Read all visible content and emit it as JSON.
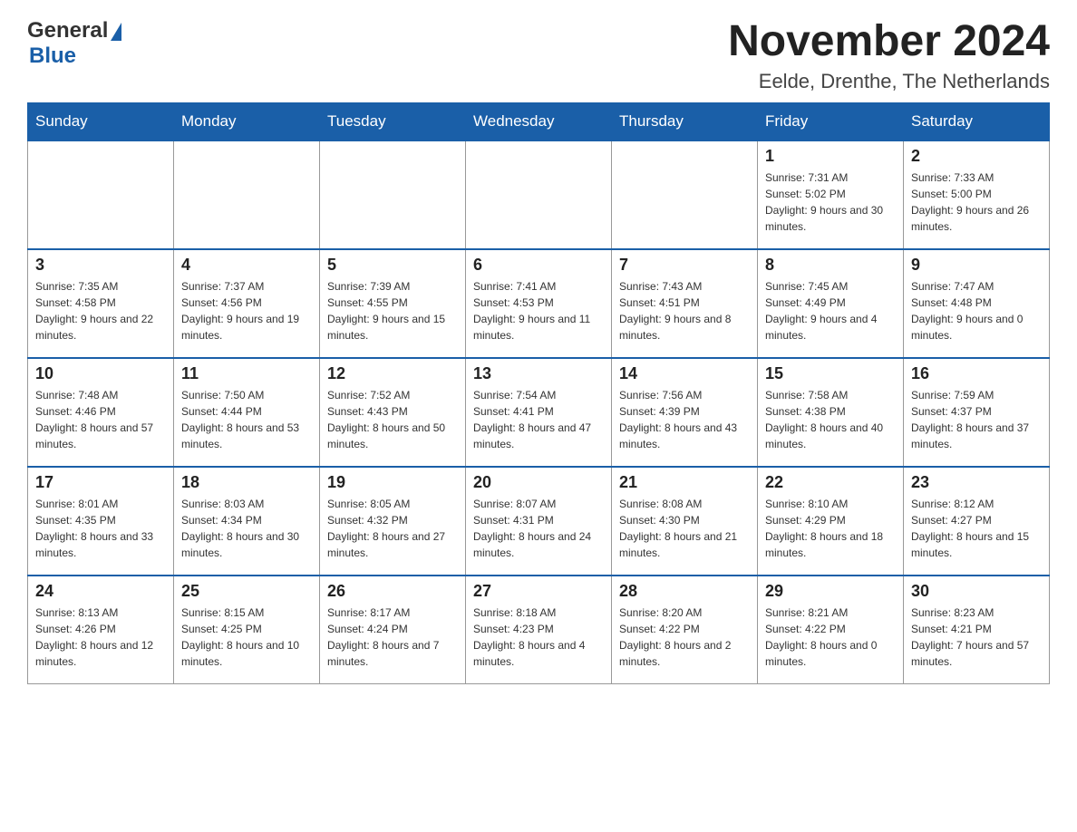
{
  "header": {
    "logo_general": "General",
    "logo_blue": "Blue",
    "title": "November 2024",
    "subtitle": "Eelde, Drenthe, The Netherlands"
  },
  "weekdays": [
    "Sunday",
    "Monday",
    "Tuesday",
    "Wednesday",
    "Thursday",
    "Friday",
    "Saturday"
  ],
  "weeks": [
    [
      {
        "day": "",
        "info": ""
      },
      {
        "day": "",
        "info": ""
      },
      {
        "day": "",
        "info": ""
      },
      {
        "day": "",
        "info": ""
      },
      {
        "day": "",
        "info": ""
      },
      {
        "day": "1",
        "info": "Sunrise: 7:31 AM\nSunset: 5:02 PM\nDaylight: 9 hours and 30 minutes."
      },
      {
        "day": "2",
        "info": "Sunrise: 7:33 AM\nSunset: 5:00 PM\nDaylight: 9 hours and 26 minutes."
      }
    ],
    [
      {
        "day": "3",
        "info": "Sunrise: 7:35 AM\nSunset: 4:58 PM\nDaylight: 9 hours and 22 minutes."
      },
      {
        "day": "4",
        "info": "Sunrise: 7:37 AM\nSunset: 4:56 PM\nDaylight: 9 hours and 19 minutes."
      },
      {
        "day": "5",
        "info": "Sunrise: 7:39 AM\nSunset: 4:55 PM\nDaylight: 9 hours and 15 minutes."
      },
      {
        "day": "6",
        "info": "Sunrise: 7:41 AM\nSunset: 4:53 PM\nDaylight: 9 hours and 11 minutes."
      },
      {
        "day": "7",
        "info": "Sunrise: 7:43 AM\nSunset: 4:51 PM\nDaylight: 9 hours and 8 minutes."
      },
      {
        "day": "8",
        "info": "Sunrise: 7:45 AM\nSunset: 4:49 PM\nDaylight: 9 hours and 4 minutes."
      },
      {
        "day": "9",
        "info": "Sunrise: 7:47 AM\nSunset: 4:48 PM\nDaylight: 9 hours and 0 minutes."
      }
    ],
    [
      {
        "day": "10",
        "info": "Sunrise: 7:48 AM\nSunset: 4:46 PM\nDaylight: 8 hours and 57 minutes."
      },
      {
        "day": "11",
        "info": "Sunrise: 7:50 AM\nSunset: 4:44 PM\nDaylight: 8 hours and 53 minutes."
      },
      {
        "day": "12",
        "info": "Sunrise: 7:52 AM\nSunset: 4:43 PM\nDaylight: 8 hours and 50 minutes."
      },
      {
        "day": "13",
        "info": "Sunrise: 7:54 AM\nSunset: 4:41 PM\nDaylight: 8 hours and 47 minutes."
      },
      {
        "day": "14",
        "info": "Sunrise: 7:56 AM\nSunset: 4:39 PM\nDaylight: 8 hours and 43 minutes."
      },
      {
        "day": "15",
        "info": "Sunrise: 7:58 AM\nSunset: 4:38 PM\nDaylight: 8 hours and 40 minutes."
      },
      {
        "day": "16",
        "info": "Sunrise: 7:59 AM\nSunset: 4:37 PM\nDaylight: 8 hours and 37 minutes."
      }
    ],
    [
      {
        "day": "17",
        "info": "Sunrise: 8:01 AM\nSunset: 4:35 PM\nDaylight: 8 hours and 33 minutes."
      },
      {
        "day": "18",
        "info": "Sunrise: 8:03 AM\nSunset: 4:34 PM\nDaylight: 8 hours and 30 minutes."
      },
      {
        "day": "19",
        "info": "Sunrise: 8:05 AM\nSunset: 4:32 PM\nDaylight: 8 hours and 27 minutes."
      },
      {
        "day": "20",
        "info": "Sunrise: 8:07 AM\nSunset: 4:31 PM\nDaylight: 8 hours and 24 minutes."
      },
      {
        "day": "21",
        "info": "Sunrise: 8:08 AM\nSunset: 4:30 PM\nDaylight: 8 hours and 21 minutes."
      },
      {
        "day": "22",
        "info": "Sunrise: 8:10 AM\nSunset: 4:29 PM\nDaylight: 8 hours and 18 minutes."
      },
      {
        "day": "23",
        "info": "Sunrise: 8:12 AM\nSunset: 4:27 PM\nDaylight: 8 hours and 15 minutes."
      }
    ],
    [
      {
        "day": "24",
        "info": "Sunrise: 8:13 AM\nSunset: 4:26 PM\nDaylight: 8 hours and 12 minutes."
      },
      {
        "day": "25",
        "info": "Sunrise: 8:15 AM\nSunset: 4:25 PM\nDaylight: 8 hours and 10 minutes."
      },
      {
        "day": "26",
        "info": "Sunrise: 8:17 AM\nSunset: 4:24 PM\nDaylight: 8 hours and 7 minutes."
      },
      {
        "day": "27",
        "info": "Sunrise: 8:18 AM\nSunset: 4:23 PM\nDaylight: 8 hours and 4 minutes."
      },
      {
        "day": "28",
        "info": "Sunrise: 8:20 AM\nSunset: 4:22 PM\nDaylight: 8 hours and 2 minutes."
      },
      {
        "day": "29",
        "info": "Sunrise: 8:21 AM\nSunset: 4:22 PM\nDaylight: 8 hours and 0 minutes."
      },
      {
        "day": "30",
        "info": "Sunrise: 8:23 AM\nSunset: 4:21 PM\nDaylight: 7 hours and 57 minutes."
      }
    ]
  ]
}
